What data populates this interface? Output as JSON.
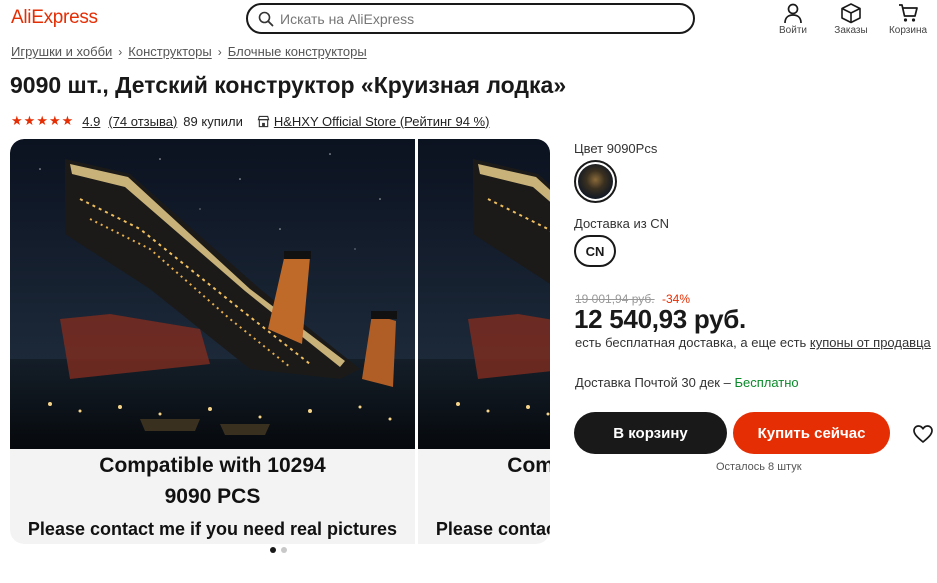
{
  "header": {
    "logo": "AliExpress",
    "search_placeholder": "Искать на AliExpress",
    "actions": [
      {
        "label": "Войти",
        "icon": "user-icon"
      },
      {
        "label": "Заказы",
        "icon": "box-icon"
      },
      {
        "label": "Корзина",
        "icon": "cart-icon"
      }
    ]
  },
  "breadcrumb": [
    "Игрушки и хобби",
    "Конструкторы",
    "Блочные конструкторы"
  ],
  "product": {
    "title": "9090 шт., Детский конструктор «Круизная лодка»",
    "rating": "4.9",
    "rating_value": 4.9,
    "reviews": "(74 отзыва)",
    "sold": "89 купили",
    "store": "H&HXY Official Store (Рейтинг 94 %)"
  },
  "gallery": {
    "caption_line1": "Compatible with 10294",
    "caption_line2": "9090 PCS",
    "caption_line3": "Please contact me if you need real pictures",
    "slide_count": 2,
    "active_slide": 1
  },
  "options": {
    "color_label": "Цвет 9090Pcs",
    "ship_from_label": "Доставка из CN",
    "ship_from_value": "CN"
  },
  "pricing": {
    "old_price": "19 001,94 руб.",
    "discount": "-34%",
    "price": "12 540,93 руб.",
    "free_shipping_text": "есть бесплатная доставка, а еще есть ",
    "coupons_link": "купоны от продавца",
    "delivery_text": "Доставка Почтой 30 дек",
    "delivery_sep": " – ",
    "delivery_free": "Бесплатно"
  },
  "actions": {
    "add_to_cart": "В корзину",
    "buy_now": "Купить сейчас",
    "stock": "Осталось 8 штук"
  },
  "colors": {
    "brand": "#e62e04",
    "dark": "#191919",
    "free_green": "#0a8a2a"
  }
}
